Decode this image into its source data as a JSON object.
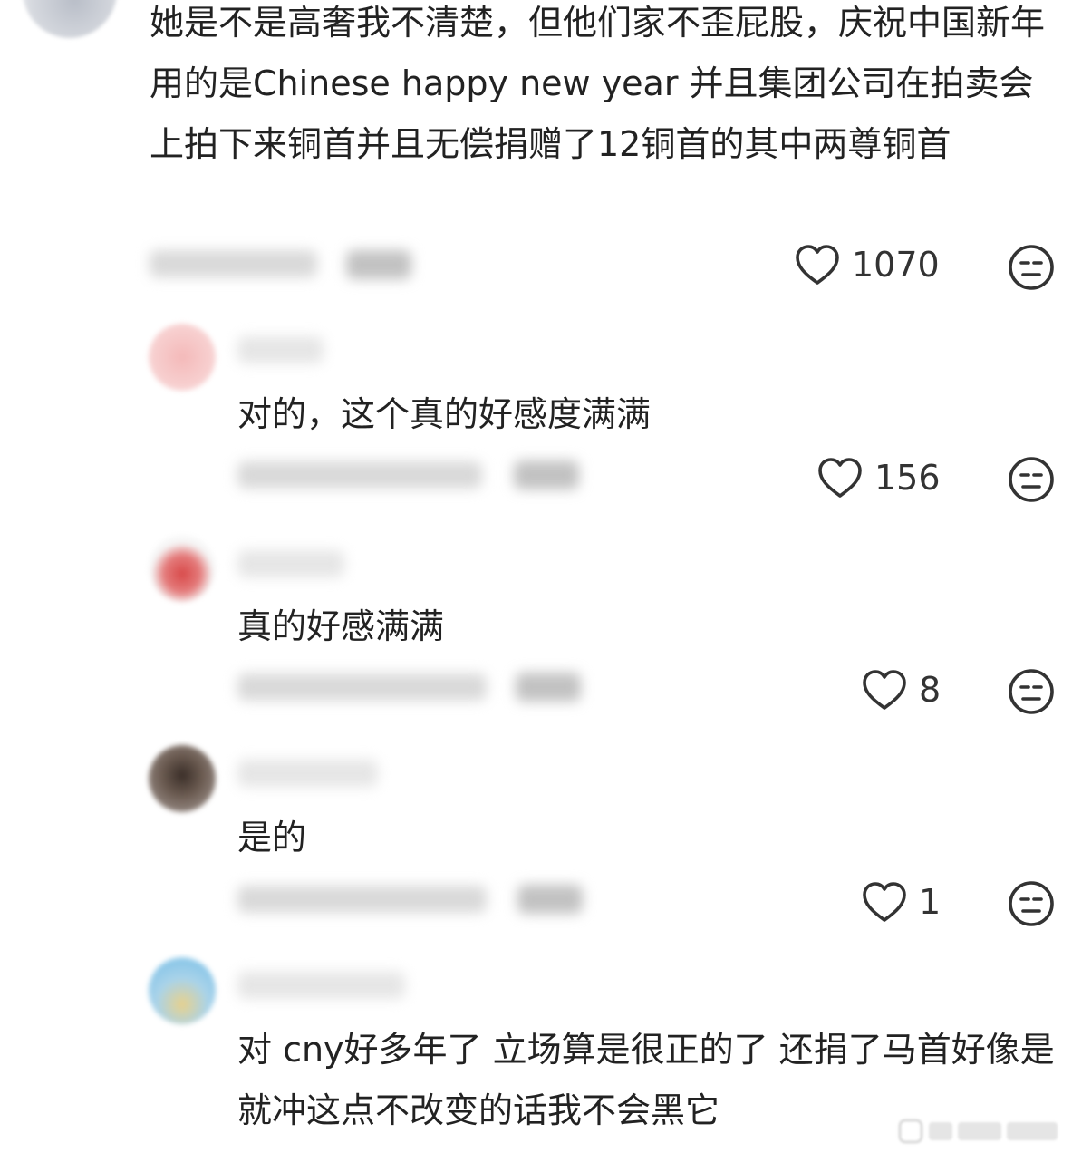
{
  "main_comment": {
    "text": "她是不是高奢我不清楚，但他们家不歪屁股，庆祝中国新年用的是Chinese happy new year 并且集团公司在拍卖会上拍下来铜首并且无偿捐赠了12铜首的其中两尊铜首",
    "likes": "1070"
  },
  "replies": [
    {
      "text": "对的，这个真的好感度满满",
      "likes": "156"
    },
    {
      "text": "真的好感满满",
      "likes": "8"
    },
    {
      "text": "是的",
      "likes": "1"
    },
    {
      "text": "对 cny好多年了 立场算是很正的了 还捐了马首好像是 就冲这点不改变的话我不会黑它"
    }
  ],
  "icons": {
    "like": "heart-outline-icon",
    "dislike": "neutral-face-icon",
    "avatar": "avatar-blurred"
  },
  "colors": {
    "text": "#222222",
    "icon": "#333333",
    "background": "#ffffff"
  }
}
